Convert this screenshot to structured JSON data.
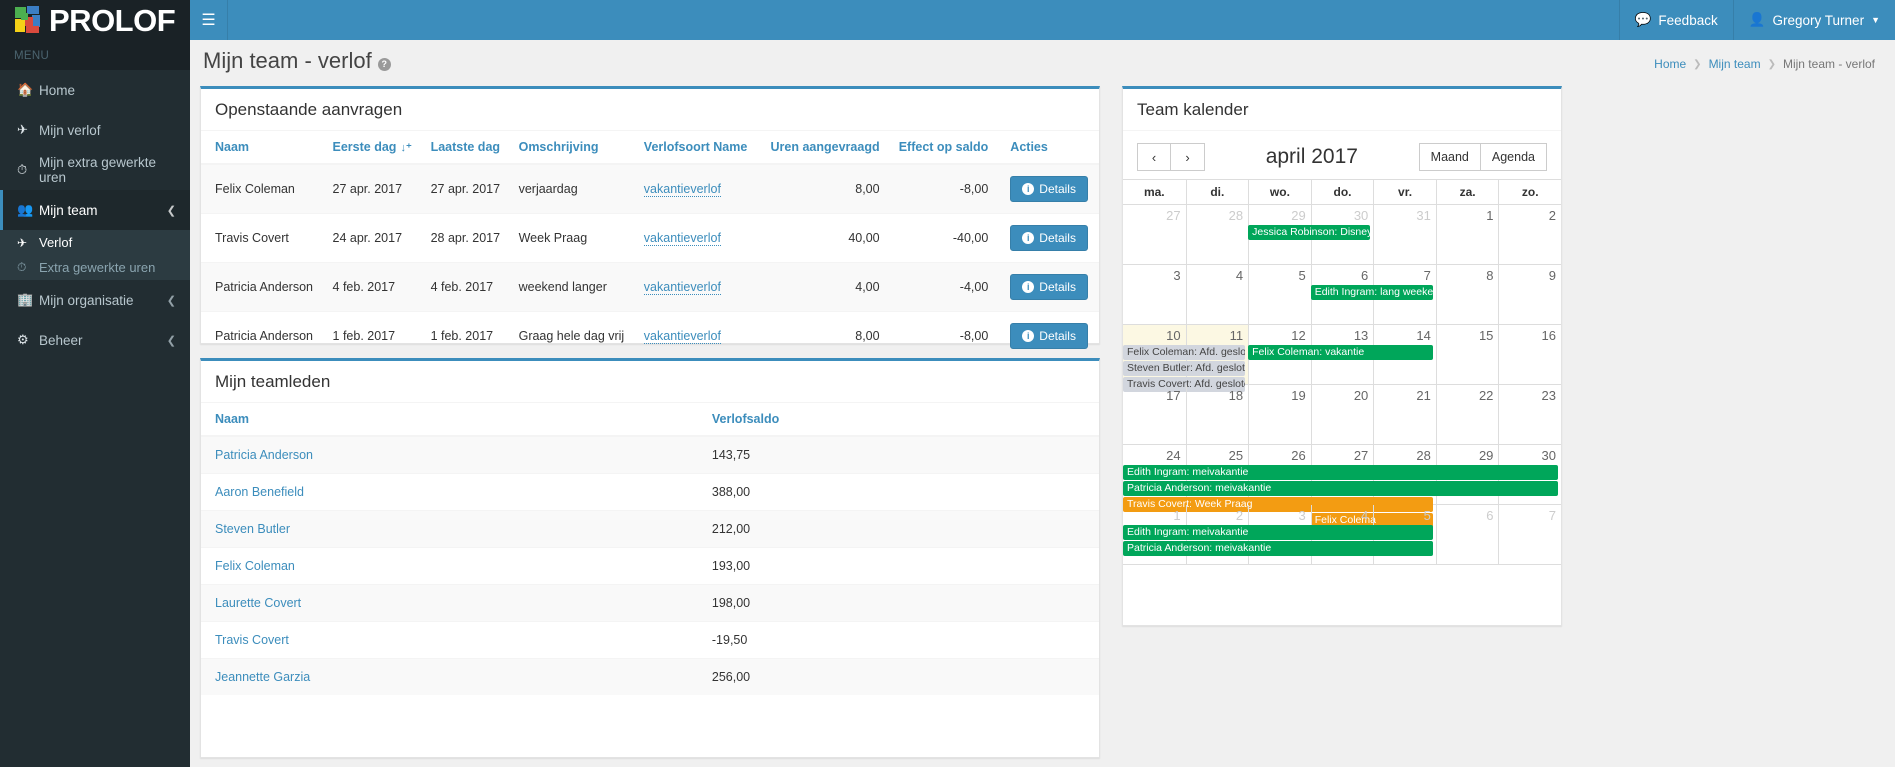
{
  "brand": {
    "name": "PROLOF",
    "logo_icon": "prolof-logo-icon"
  },
  "sidebar": {
    "menu_label": "MENU",
    "items": [
      {
        "label": "Home",
        "icon": "home-icon",
        "active": false,
        "caret": false
      },
      {
        "label": "Mijn verlof",
        "icon": "plane-icon",
        "active": false,
        "caret": false
      },
      {
        "label": "Mijn extra gewerkte uren",
        "icon": "clock-icon",
        "active": false,
        "caret": false
      },
      {
        "label": "Mijn team",
        "icon": "users-icon",
        "active": true,
        "caret": true
      },
      {
        "label": "Mijn organisatie",
        "icon": "building-icon",
        "active": false,
        "caret": true
      },
      {
        "label": "Beheer",
        "icon": "gear-icon",
        "active": false,
        "caret": true
      }
    ],
    "sub_items": [
      {
        "label": "Verlof",
        "icon": "plane-icon",
        "active": true
      },
      {
        "label": "Extra gewerkte uren",
        "icon": "clock-icon",
        "active": false
      }
    ]
  },
  "topbar": {
    "hamburger_icon": "hamburger-icon",
    "feedback_label": "Feedback",
    "feedback_icon": "comments-icon",
    "user_name": "Gregory Turner",
    "user_icon": "user-icon",
    "caret_icon": "caret-down-icon"
  },
  "header": {
    "title": "Mijn team - verlof",
    "help_icon": "?",
    "breadcrumb": [
      "Home",
      "Mijn team",
      "Mijn team - verlof"
    ]
  },
  "requests_panel": {
    "title": "Openstaande aanvragen",
    "columns": [
      "Naam",
      "Eerste dag",
      "Laatste dag",
      "Omschrijving",
      "Verlofsoort Name",
      "Uren aangevraagd",
      "Effect op saldo",
      "Acties"
    ],
    "sorted_column": "Eerste dag",
    "sort_icon": "sort-desc-icon",
    "action_label": "Details",
    "rows": [
      {
        "naam": "Felix Coleman",
        "eerste_dag": "27 apr. 2017",
        "laatste_dag": "27 apr. 2017",
        "omschrijving": "verjaardag",
        "verlofsoort": "vakantieverlof",
        "uren": "8,00",
        "effect": "-8,00"
      },
      {
        "naam": "Travis Covert",
        "eerste_dag": "24 apr. 2017",
        "laatste_dag": "28 apr. 2017",
        "omschrijving": "Week Praag",
        "verlofsoort": "vakantieverlof",
        "uren": "40,00",
        "effect": "-40,00"
      },
      {
        "naam": "Patricia Anderson",
        "eerste_dag": "4 feb. 2017",
        "laatste_dag": "4 feb. 2017",
        "omschrijving": "weekend langer",
        "verlofsoort": "vakantieverlof",
        "uren": "4,00",
        "effect": "-4,00"
      },
      {
        "naam": "Patricia Anderson",
        "eerste_dag": "1 feb. 2017",
        "laatste_dag": "1 feb. 2017",
        "omschrijving": "Graag hele dag vrij",
        "verlofsoort": "vakantieverlof",
        "uren": "8,00",
        "effect": "-8,00"
      }
    ]
  },
  "members_panel": {
    "title": "Mijn teamleden",
    "columns": [
      "Naam",
      "Verlofsaldo"
    ],
    "rows": [
      {
        "naam": "Patricia Anderson",
        "saldo": "143,75"
      },
      {
        "naam": "Aaron Benefield",
        "saldo": "388,00"
      },
      {
        "naam": "Steven Butler",
        "saldo": "212,00"
      },
      {
        "naam": "Felix Coleman",
        "saldo": "193,00"
      },
      {
        "naam": "Laurette Covert",
        "saldo": "198,00"
      },
      {
        "naam": "Travis Covert",
        "saldo": "-19,50"
      },
      {
        "naam": "Jeannette Garzia",
        "saldo": "256,00"
      }
    ]
  },
  "calendar_panel": {
    "title": "Team kalender",
    "prev_icon": "chevron-left-icon",
    "next_icon": "chevron-right-icon",
    "month_title": "april 2017",
    "views": [
      "Maand",
      "Agenda"
    ],
    "active_view": "Maand",
    "day_names": [
      "ma.",
      "di.",
      "wo.",
      "do.",
      "vr.",
      "za.",
      "zo."
    ],
    "weeks": [
      {
        "days": [
          {
            "n": "27",
            "other": true
          },
          {
            "n": "28",
            "other": true
          },
          {
            "n": "29",
            "other": true
          },
          {
            "n": "30",
            "other": true
          },
          {
            "n": "31",
            "other": true
          },
          {
            "n": "1",
            "other": false
          },
          {
            "n": "2",
            "other": false
          }
        ],
        "events": [
          {
            "label": "Jessica Robinson: Disney",
            "color": "green",
            "start": 2,
            "span": 2,
            "row": 0
          }
        ]
      },
      {
        "days": [
          {
            "n": "3"
          },
          {
            "n": "4"
          },
          {
            "n": "5"
          },
          {
            "n": "6"
          },
          {
            "n": "7"
          },
          {
            "n": "8"
          },
          {
            "n": "9"
          }
        ],
        "events": [
          {
            "label": "Edith Ingram: lang weekend",
            "color": "green",
            "start": 3,
            "span": 2,
            "row": 0
          }
        ]
      },
      {
        "days": [
          {
            "n": "10",
            "today": true
          },
          {
            "n": "11",
            "today": true
          },
          {
            "n": "12"
          },
          {
            "n": "13"
          },
          {
            "n": "14"
          },
          {
            "n": "15"
          },
          {
            "n": "16"
          }
        ],
        "events": [
          {
            "label": "Felix Coleman: Afd. gesloten",
            "color": "grey",
            "start": 0,
            "span": 2,
            "row": 0
          },
          {
            "label": "Felix Coleman: vakantie",
            "color": "green",
            "start": 2,
            "span": 3,
            "row": 0
          },
          {
            "label": "Steven Butler: Afd. gesloten",
            "color": "grey",
            "start": 0,
            "span": 2,
            "row": 1
          },
          {
            "label": "Travis Covert: Afd. gesloten",
            "color": "grey",
            "start": 0,
            "span": 2,
            "row": 2
          }
        ]
      },
      {
        "days": [
          {
            "n": "17"
          },
          {
            "n": "18"
          },
          {
            "n": "19"
          },
          {
            "n": "20"
          },
          {
            "n": "21"
          },
          {
            "n": "22"
          },
          {
            "n": "23"
          }
        ],
        "events": []
      },
      {
        "days": [
          {
            "n": "24"
          },
          {
            "n": "25"
          },
          {
            "n": "26"
          },
          {
            "n": "27"
          },
          {
            "n": "28"
          },
          {
            "n": "29"
          },
          {
            "n": "30"
          }
        ],
        "events": [
          {
            "label": "Edith Ingram: meivakantie",
            "color": "green",
            "start": 0,
            "span": 7,
            "row": 0
          },
          {
            "label": "Patricia Anderson: meivakantie",
            "color": "green",
            "start": 0,
            "span": 7,
            "row": 1
          },
          {
            "label": "Travis Covert: Week Praag",
            "color": "orange",
            "start": 0,
            "span": 5,
            "row": 2
          },
          {
            "label": "Felix Colema",
            "color": "orange",
            "start": 3,
            "span": 2,
            "row": 3
          }
        ]
      },
      {
        "days": [
          {
            "n": "1",
            "other": true
          },
          {
            "n": "2",
            "other": true
          },
          {
            "n": "3",
            "other": true
          },
          {
            "n": "4",
            "other": true
          },
          {
            "n": "5",
            "other": true
          },
          {
            "n": "6",
            "other": true
          },
          {
            "n": "7",
            "other": true
          }
        ],
        "events": [
          {
            "label": "Edith Ingram: meivakantie",
            "color": "green",
            "start": 0,
            "span": 5,
            "row": 0
          },
          {
            "label": "Patricia Anderson: meivakantie",
            "color": "green",
            "start": 0,
            "span": 5,
            "row": 1
          }
        ]
      }
    ]
  }
}
